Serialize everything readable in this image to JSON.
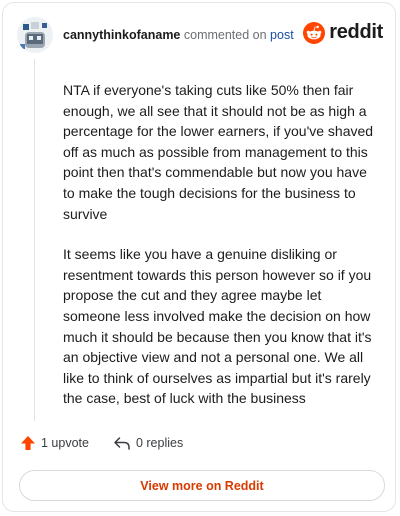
{
  "comment": {
    "username": "cannythinkofaname",
    "action_text": "commented on",
    "post_link": "post",
    "paragraphs": [
      "NTA if everyone's taking cuts like 50% then fair enough, we all see that it should not be as high a percentage for the lower earners, if you've shaved off as much as possible from management to this point then that's commendable but now you have to make the tough decisions for the business to survive",
      "It seems like you have a genuine disliking or resentment towards this person however so if you propose the cut and they agree maybe let someone less involved make the decision on how much it should be because then you know that it's an objective view and not a personal one. We all like to think of ourselves as impartial but it's rarely the case, best of luck with the business"
    ],
    "upvotes_label": "1 upvote",
    "replies_label": "0 replies"
  },
  "brand": {
    "wordmark": "reddit",
    "color": "#ff4500"
  },
  "footer": {
    "view_more_label": "View more on Reddit"
  },
  "icons": {
    "avatar": "avatar-icon",
    "upvote": "upvote-arrow-icon",
    "reply": "reply-arrow-icon",
    "logo": "reddit-alien-icon"
  },
  "colors": {
    "upvote": "#ff4500",
    "link": "#1a4fa0",
    "view_more": "#d93a00"
  }
}
